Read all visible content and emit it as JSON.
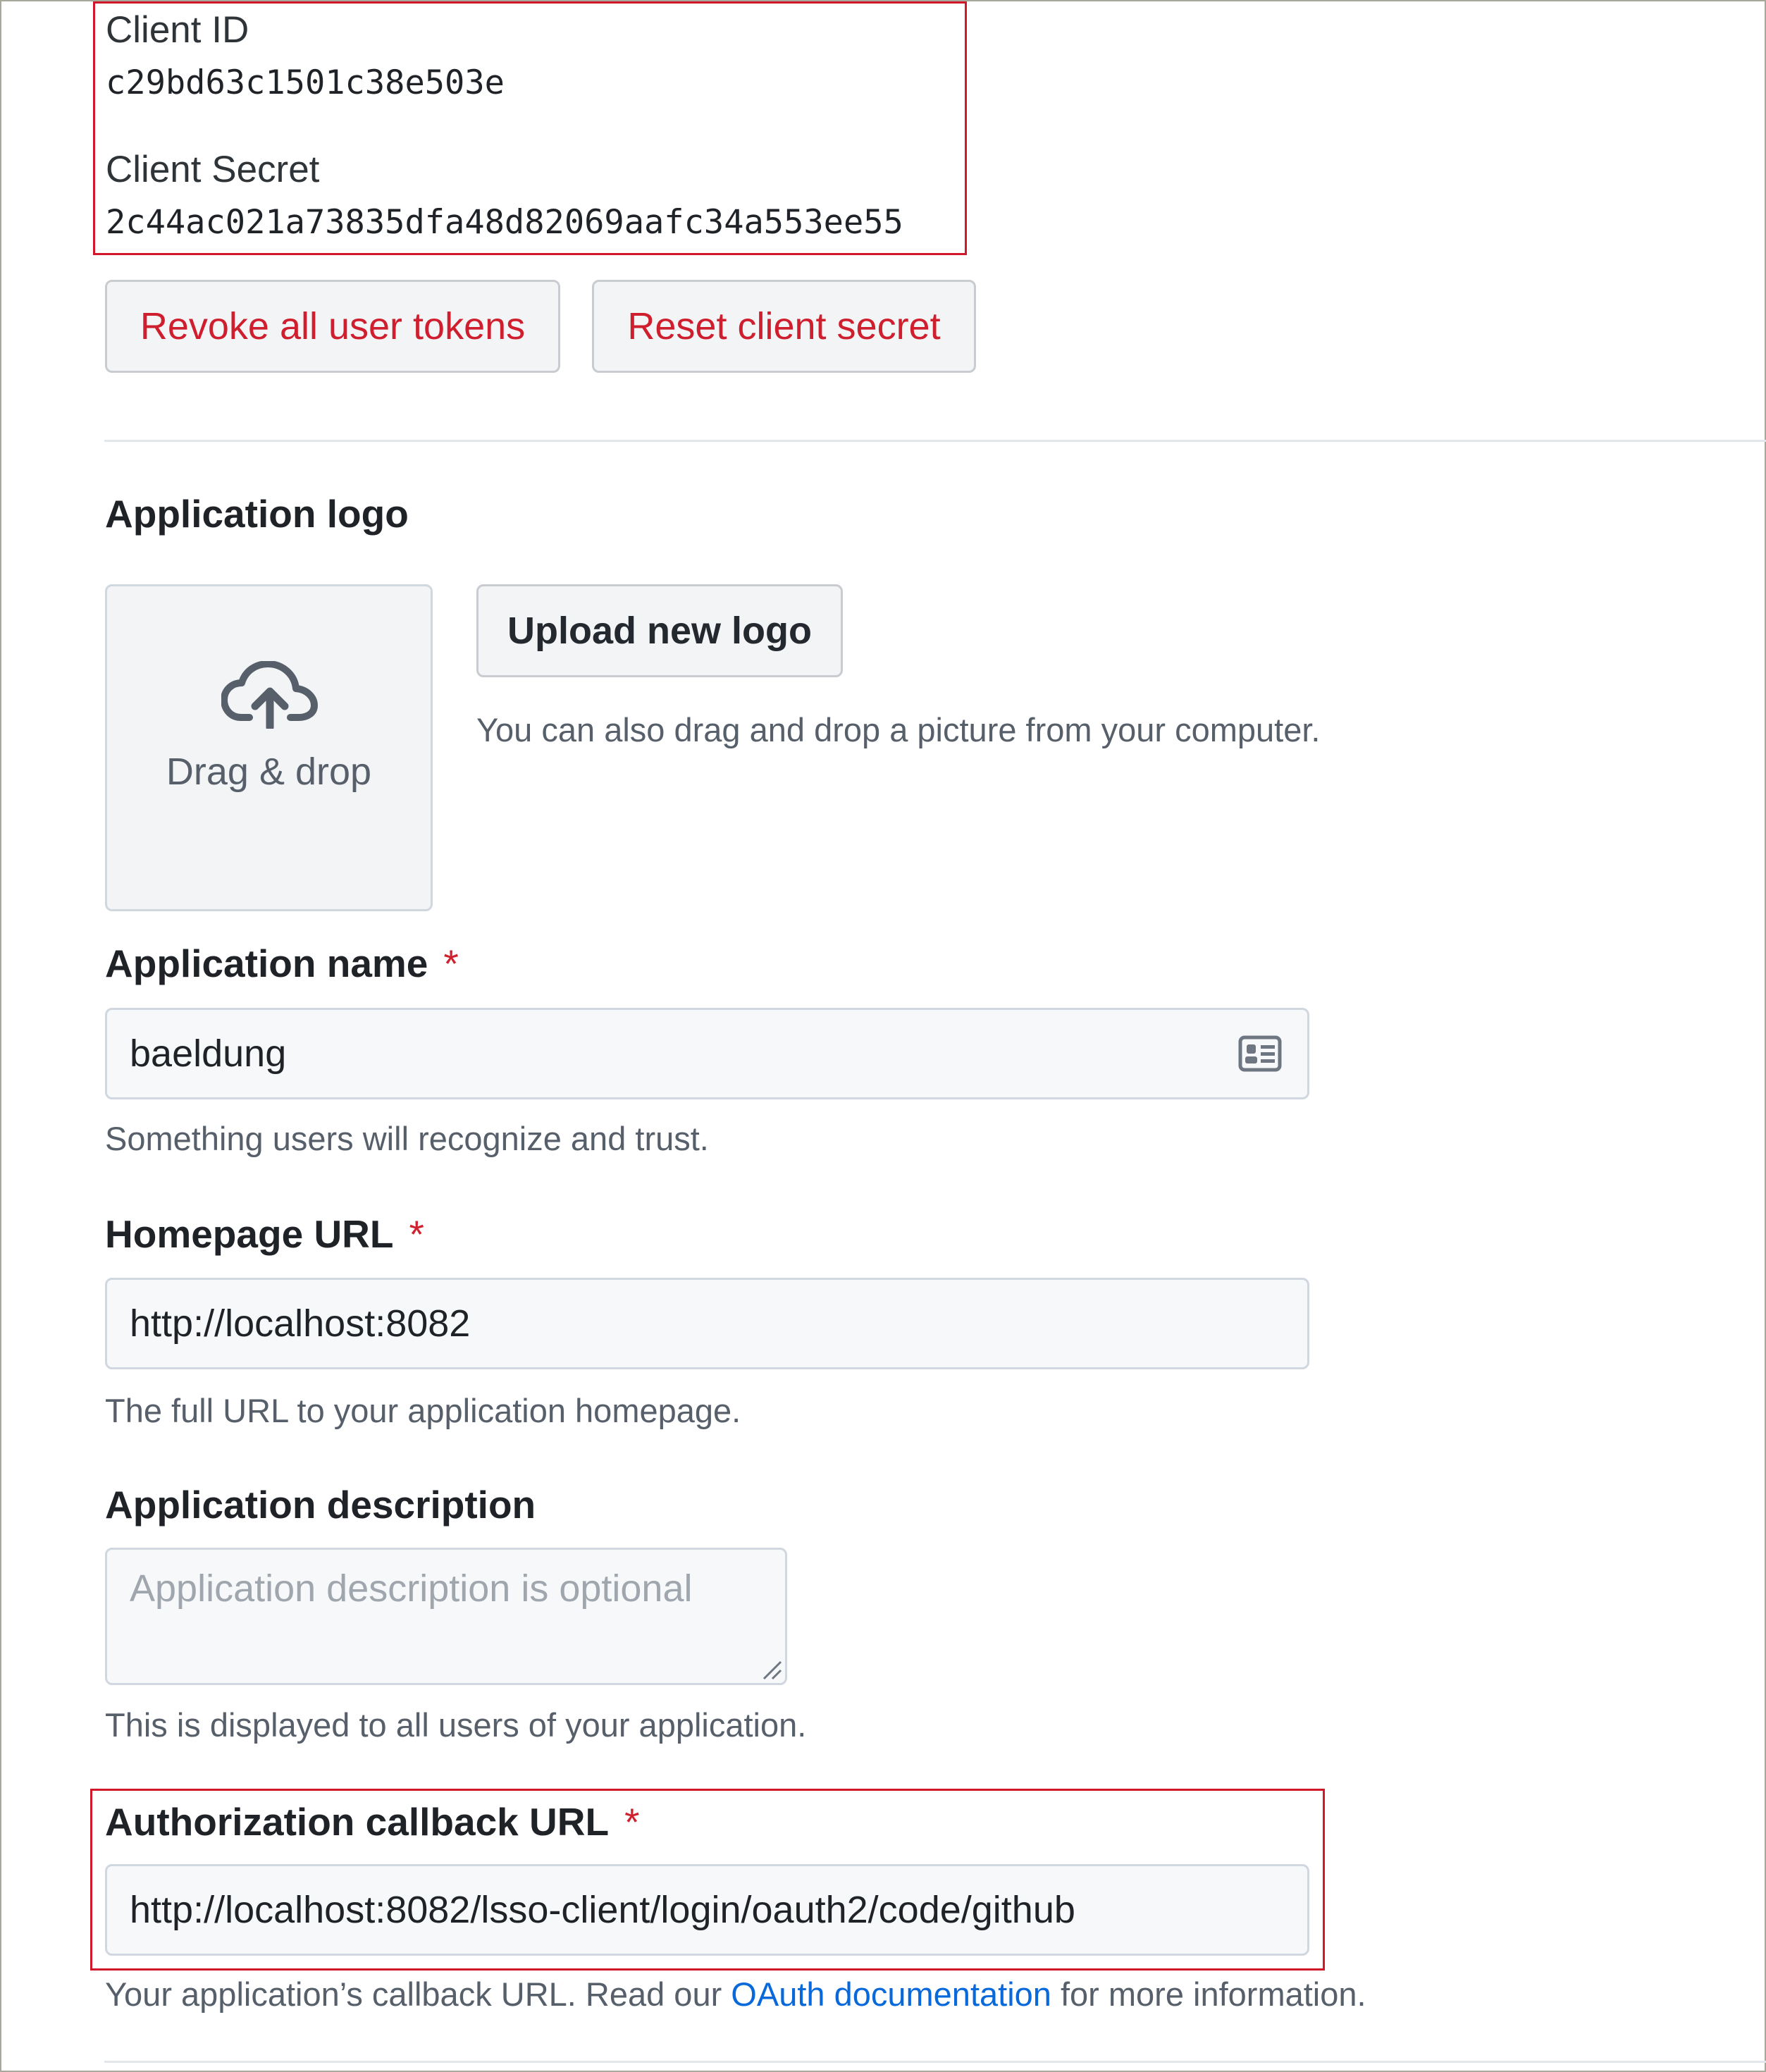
{
  "credentials": {
    "client_id_label": "Client ID",
    "client_id_value": "c29bd63c1501c38e503e",
    "client_secret_label": "Client Secret",
    "client_secret_value": "2c44ac021a73835dfa48d82069aafc34a553ee55"
  },
  "actions": {
    "revoke_label": "Revoke all user tokens",
    "reset_label": "Reset client secret"
  },
  "logo": {
    "heading": "Application logo",
    "dropzone_label": "Drag & drop",
    "upload_label": "Upload new logo",
    "help": "You can also drag and drop a picture from your computer."
  },
  "app_name": {
    "label": "Application name",
    "required": "*",
    "value": "baeldung",
    "help": "Something users will recognize and trust."
  },
  "homepage": {
    "label": "Homepage URL",
    "required": "*",
    "value": "http://localhost:8082",
    "help": "The full URL to your application homepage."
  },
  "description": {
    "label": "Application description",
    "placeholder": "Application description is optional",
    "help": "This is displayed to all users of your application."
  },
  "callback": {
    "label": "Authorization callback URL",
    "required": "*",
    "value": "http://localhost:8082/lsso-client/login/oauth2/code/github",
    "help_prefix": "Your application’s callback URL. Read our ",
    "help_link": "OAuth documentation",
    "help_suffix": " for more information."
  },
  "icons": {
    "upload": "cloud-upload-icon",
    "autofill": "contact-card-icon"
  },
  "colors": {
    "highlight_box": "#d0182a",
    "danger_text": "#cf1f2e",
    "link": "#0969da",
    "required": "#cf222e"
  }
}
